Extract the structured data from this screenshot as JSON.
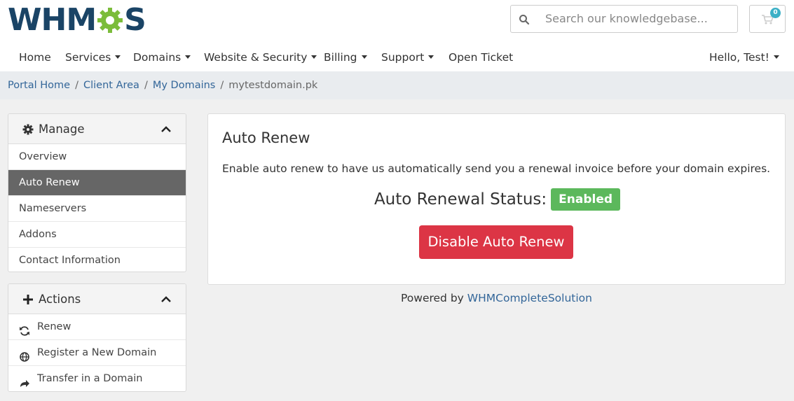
{
  "brand": {
    "logo_prefix": "WHM",
    "logo_suffix": "S",
    "colors": {
      "navy": "#1a4466",
      "green": "#7bbc3a",
      "link": "#336699",
      "danger": "#dc3545",
      "success": "#5cb85c"
    }
  },
  "search": {
    "placeholder": "Search our knowledgebase...",
    "icon": "search-icon"
  },
  "cart": {
    "count": "0",
    "icon": "cart-icon"
  },
  "nav": {
    "items": [
      {
        "label": "Home",
        "dropdown": false
      },
      {
        "label": "Services",
        "dropdown": true
      },
      {
        "label": "Domains",
        "dropdown": true
      },
      {
        "label": "Website & Security",
        "dropdown": true
      },
      {
        "label": "Billing",
        "dropdown": true
      },
      {
        "label": "Support",
        "dropdown": true
      },
      {
        "label": "Open Ticket",
        "dropdown": false
      }
    ],
    "user": "Hello, Test!"
  },
  "breadcrumb": {
    "items": [
      "Portal Home",
      "Client Area",
      "My Domains"
    ],
    "current": "mytestdomain.pk",
    "separator": "/"
  },
  "sidebar": {
    "manage": {
      "title": "Manage",
      "icon": "gear-icon",
      "items": [
        "Overview",
        "Auto Renew",
        "Nameservers",
        "Addons",
        "Contact Information"
      ],
      "active": "Auto Renew"
    },
    "actions": {
      "title": "Actions",
      "icon": "plus-icon",
      "items": [
        {
          "label": "Renew",
          "icon": "refresh-icon"
        },
        {
          "label": "Register a New Domain",
          "icon": "globe-icon"
        },
        {
          "label": "Transfer in a Domain",
          "icon": "share-arrow-icon"
        }
      ]
    }
  },
  "main": {
    "title": "Auto Renew",
    "description": "Enable auto renew to have us automatically send you a renewal invoice before your domain expires.",
    "status_label": "Auto Renewal Status:",
    "status_value": "Enabled",
    "button_label": "Disable Auto Renew"
  },
  "footer": {
    "prefix": "Powered by",
    "link": "WHMCompleteSolution"
  }
}
